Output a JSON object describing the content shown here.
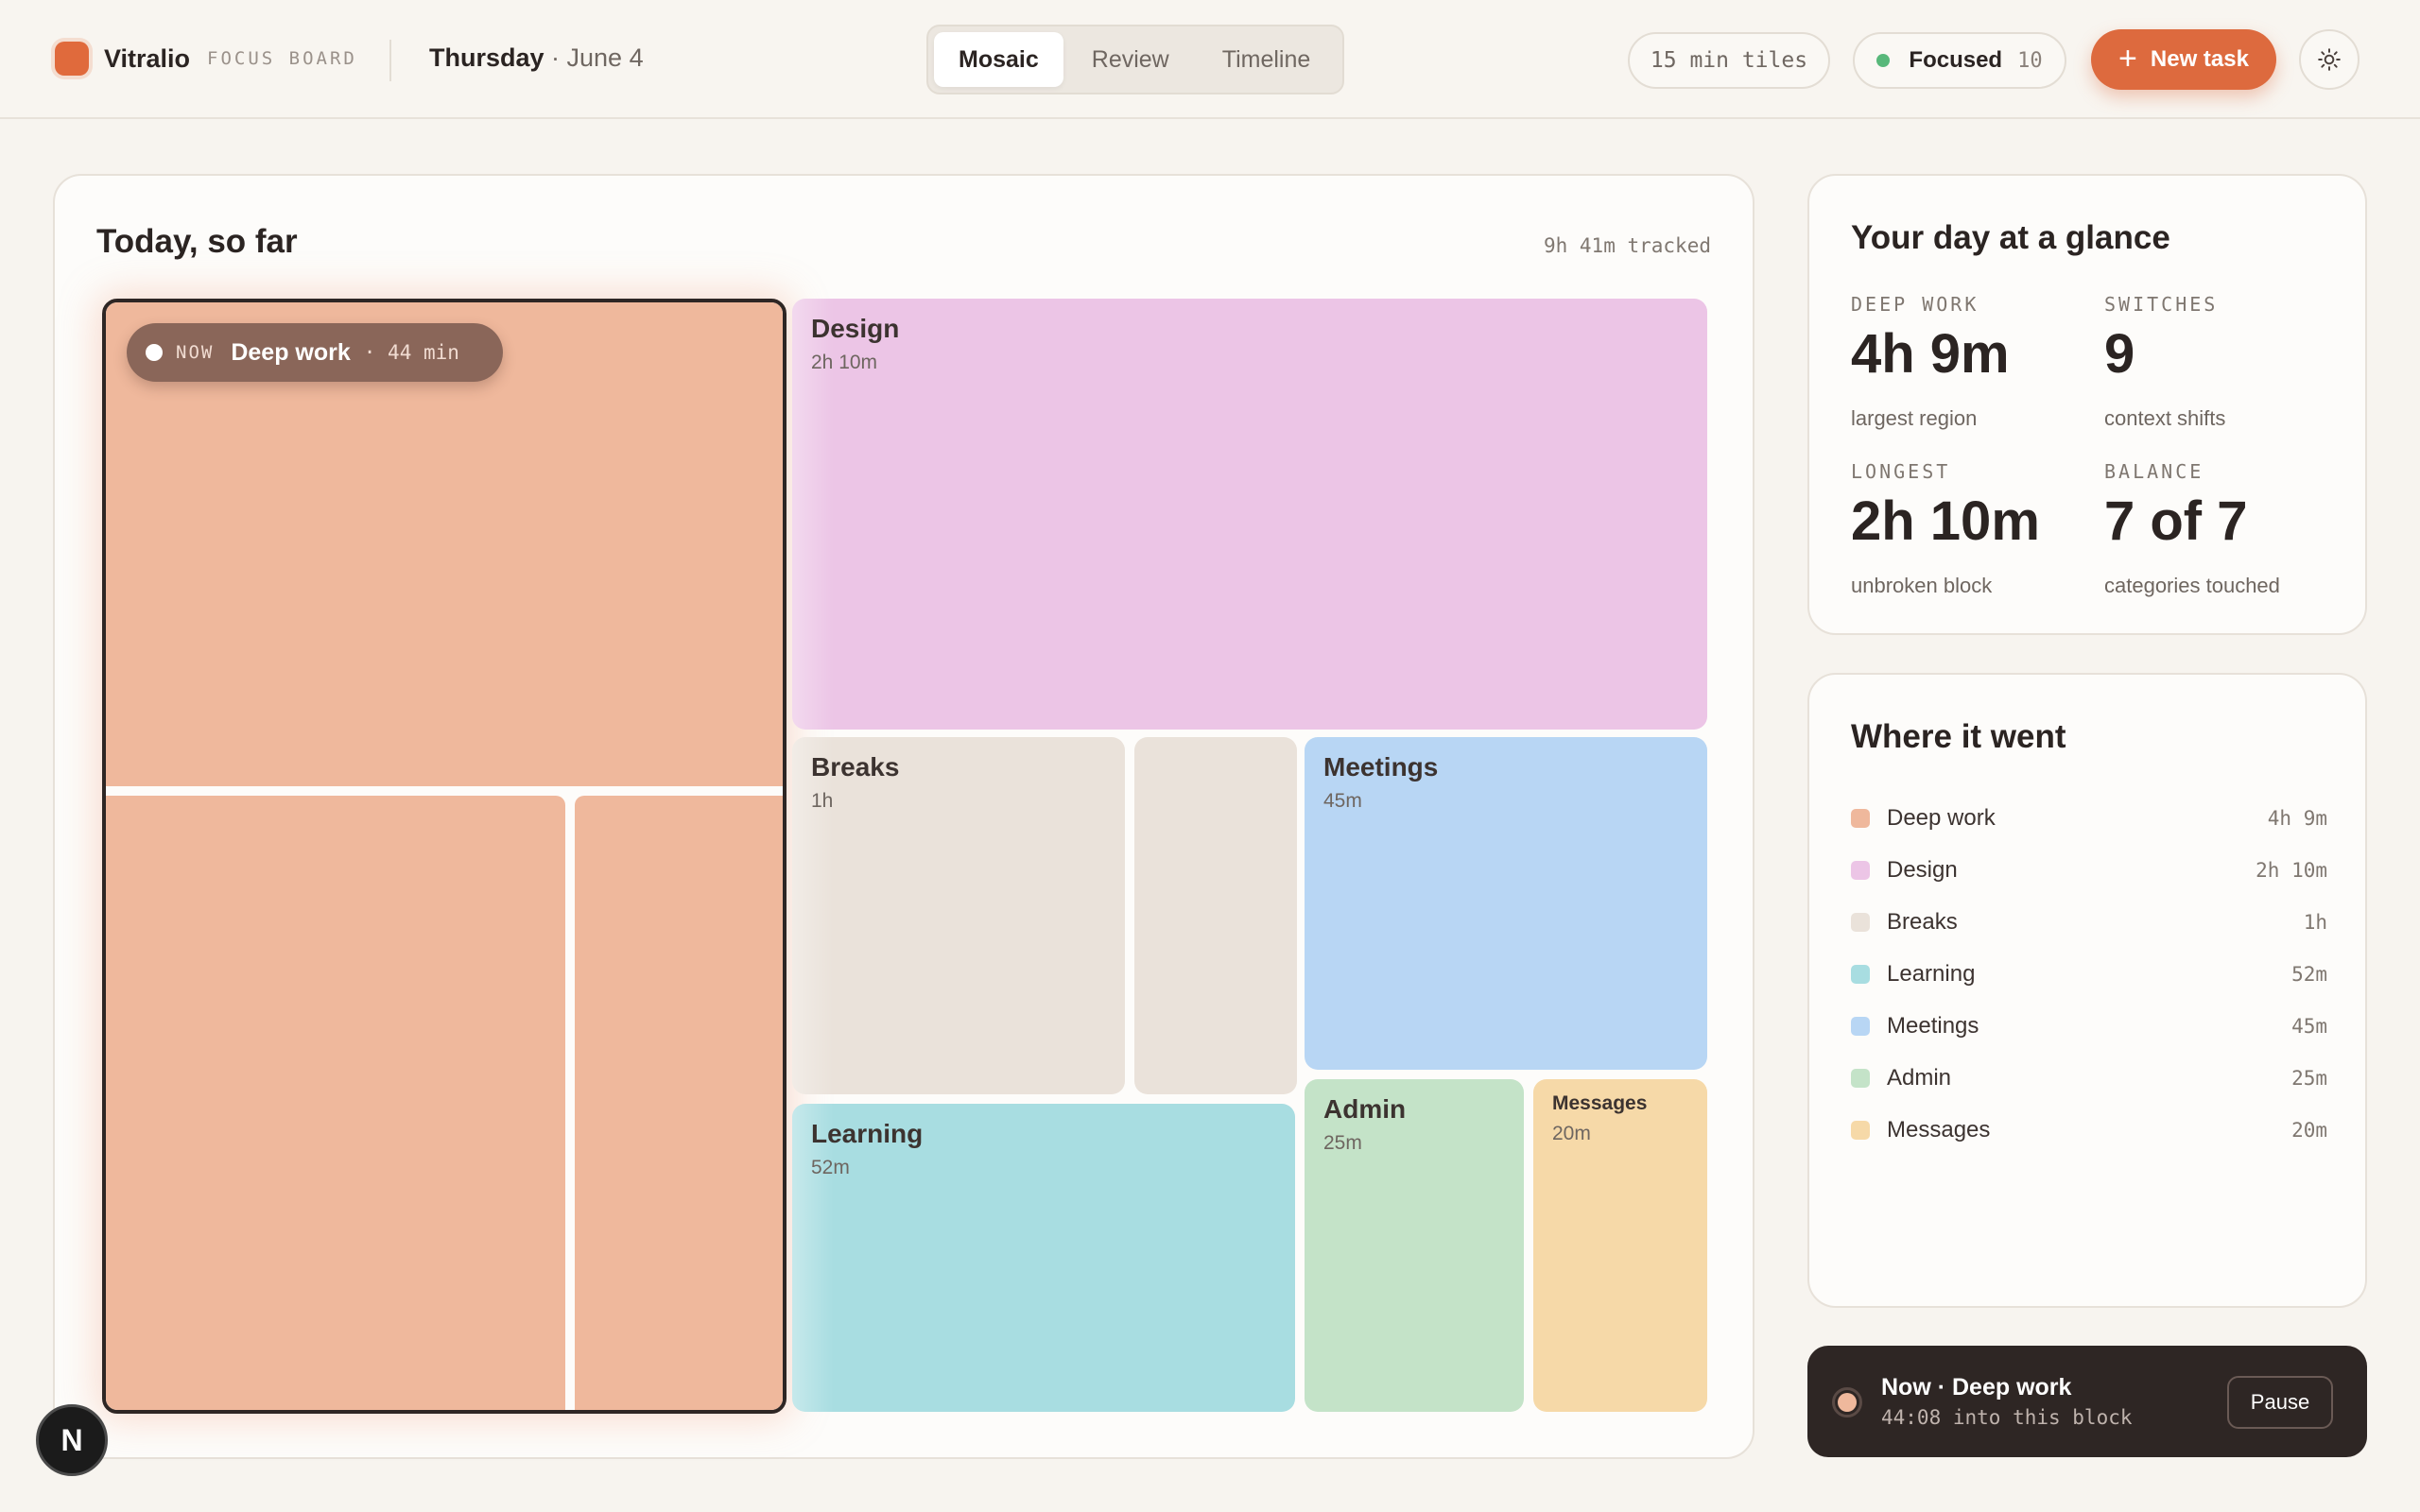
{
  "brand": {
    "name": "Vitralio",
    "sub": "FOCUS BOARD"
  },
  "date": {
    "day": "Thursday",
    "rest": " · June 4"
  },
  "view_tabs": [
    {
      "label": "Mosaic",
      "active": true
    },
    {
      "label": "Review",
      "active": false
    },
    {
      "label": "Timeline",
      "active": false
    }
  ],
  "toolbar": {
    "tile_size": "15 min tiles",
    "focus_label": "Focused",
    "focus_count": "10",
    "new_task": "New task",
    "new_task_icon": "plus-icon",
    "theme_icon": "sun-icon"
  },
  "main": {
    "title": "Today, so far",
    "tracked": "9h 41m tracked",
    "now_chip": {
      "tag": "NOW",
      "name": "Deep work",
      "time": "· 44 min"
    },
    "tiles": {
      "design": {
        "label": "Design",
        "sub": "2h 10m"
      },
      "breaks": {
        "label": "Breaks",
        "sub": "1h"
      },
      "meetings": {
        "label": "Meetings",
        "sub": "45m"
      },
      "learning": {
        "label": "Learning",
        "sub": "52m"
      },
      "admin": {
        "label": "Admin",
        "sub": "25m"
      },
      "messages": {
        "label": "Messages",
        "sub": "20m"
      }
    }
  },
  "glance": {
    "title": "Your day at a glance",
    "stats": [
      {
        "key": "DEEP WORK",
        "value": "4h 9m",
        "sub": "largest region"
      },
      {
        "key": "SWITCHES",
        "value": "9",
        "sub": "context shifts"
      },
      {
        "key": "LONGEST",
        "value": "2h 10m",
        "sub": "unbroken block"
      },
      {
        "key": "BALANCE",
        "value": "7 of 7",
        "sub": "categories touched"
      }
    ]
  },
  "where": {
    "title": "Where it went",
    "items": [
      {
        "name": "Deep work",
        "value": "4h 9m",
        "color": "#efb89c"
      },
      {
        "name": "Design",
        "value": "2h 10m",
        "color": "#ecc5e6"
      },
      {
        "name": "Breaks",
        "value": "1h",
        "color": "#eae2da"
      },
      {
        "name": "Learning",
        "value": "52m",
        "color": "#a8dde1"
      },
      {
        "name": "Meetings",
        "value": "45m",
        "color": "#b8d6f4"
      },
      {
        "name": "Admin",
        "value": "25m",
        "color": "#c4e3c8"
      },
      {
        "name": "Messages",
        "value": "20m",
        "color": "#f6d9a8"
      }
    ]
  },
  "now_bar": {
    "title": "Now · Deep work",
    "sub": "44:08 into this block",
    "pause": "Pause"
  },
  "badge": "N",
  "colors": {
    "accent": "#dd6a3e",
    "deep_work": "#efb89c",
    "design": "#ecc5e6",
    "breaks": "#eae2da",
    "learning": "#a8dde1",
    "meetings": "#b8d6f4",
    "admin": "#c4e3c8",
    "messages": "#f6d9a8"
  }
}
